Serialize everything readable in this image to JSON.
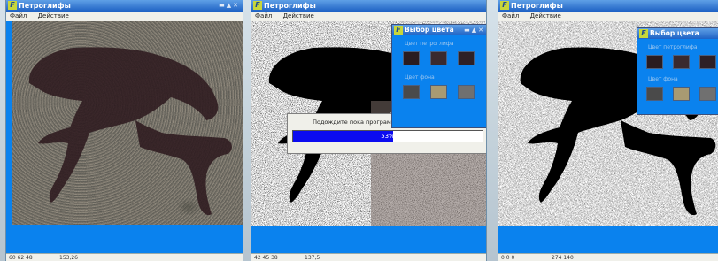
{
  "colors": {
    "window_blue": "#0a82ee",
    "progress_fill": "#0b0bf0",
    "animal_dark": "#3a2328",
    "swatch_dark_1": "#2a1c20",
    "swatch_dark_2": "#3a2a2e",
    "swatch_dark_3": "#2e2025",
    "swatch_bg_1": "#4a4a4a",
    "swatch_bg_2": "#a89a72",
    "swatch_bg_3": "#707070"
  },
  "window1": {
    "title": "Петроглифы",
    "menu": [
      "Файл",
      "Действие"
    ],
    "status_a": "60 62 48",
    "status_b": "153,26"
  },
  "window2": {
    "title": "Петроглифы",
    "menu": [
      "Файл",
      "Действие"
    ],
    "status_a": "42 45 38",
    "status_b": "137,5",
    "dialog_text": "Подождите пока программа выполнит операцию",
    "progress_label": "53%",
    "progress_value": 0.53
  },
  "window3": {
    "title": "Петроглифы",
    "menu": [
      "Файл",
      "Действие"
    ],
    "status_a": "0 0 0",
    "status_b": "274 140"
  },
  "color_picker": {
    "title": "Выбор цвета",
    "label_figure": "Цвет петроглифа",
    "label_bg": "Цвет фона"
  },
  "icons": [
    "app-logo-icon",
    "minimize-icon",
    "maximize-icon",
    "close-icon"
  ]
}
